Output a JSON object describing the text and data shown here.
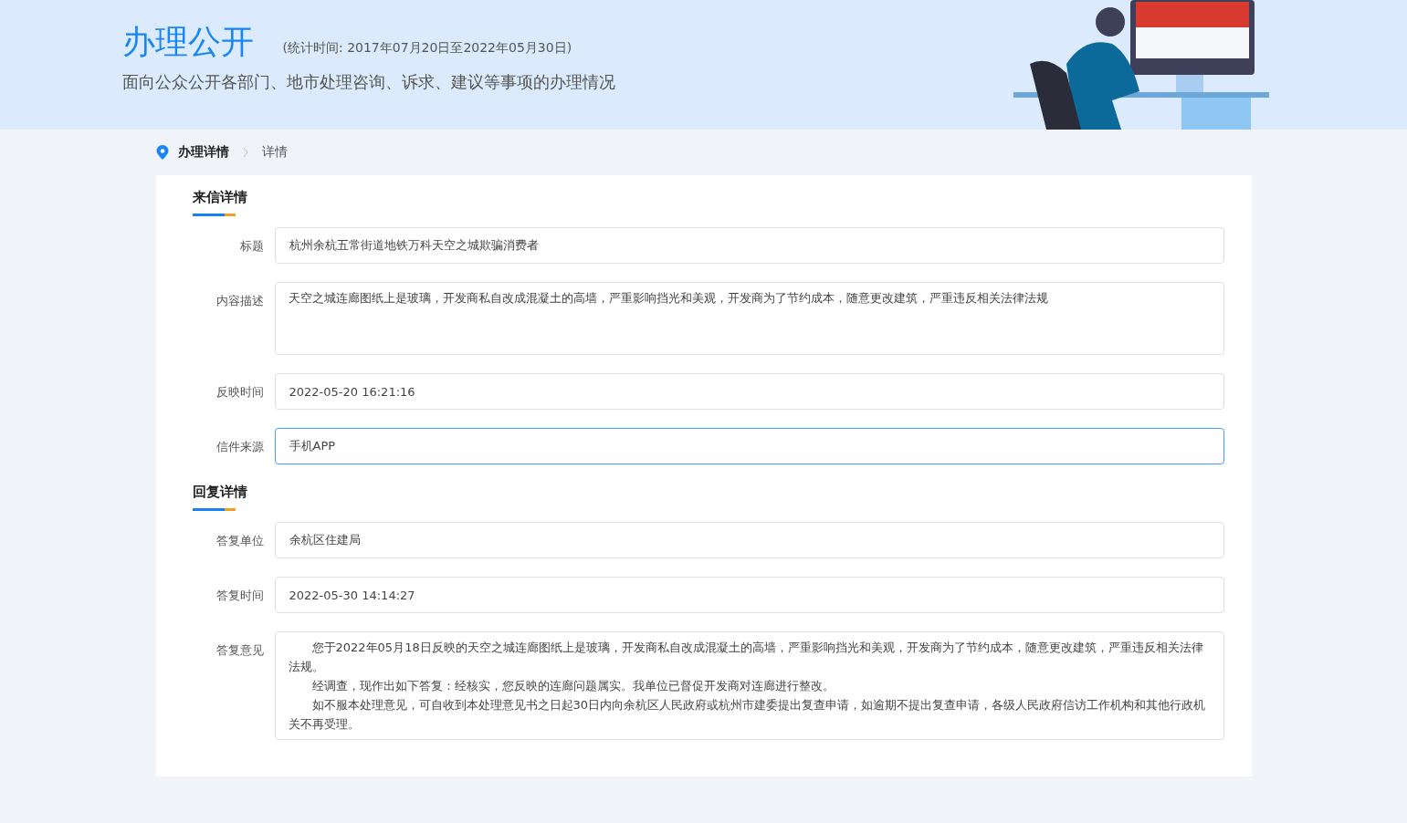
{
  "banner": {
    "title": "办理公开",
    "period": "(统计时间: 2017年07月20日至2022年05月30日)",
    "subtitle": "面向公众公开各部门、地市处理咨询、诉求、建议等事项的办理情况"
  },
  "breadcrumb": [
    {
      "label": "办理详情",
      "current": false
    },
    {
      "label": "详情",
      "current": true
    }
  ],
  "sections": [
    {
      "title": "来信详情",
      "fields": [
        {
          "label": "标题",
          "kind": "input",
          "value": "杭州余杭五常街道地铁万科天空之城欺骗消费者",
          "focused": false
        },
        {
          "label": "内容描述",
          "kind": "textarea",
          "paragraphs": [
            "天空之城连廊图纸上是玻璃，开发商私自改成混凝土的高墙，严重影响挡光和美观，开发商为了节约成本，随意更改建筑，严重违反相关法律法规"
          ],
          "indent": false,
          "focused": false
        },
        {
          "label": "反映时间",
          "kind": "input",
          "value": "2022-05-20 16:21:16",
          "focused": false
        },
        {
          "label": "信件来源",
          "kind": "input",
          "value": "手机APP",
          "focused": true
        }
      ]
    },
    {
      "title": "回复详情",
      "fields": [
        {
          "label": "答复单位",
          "kind": "input",
          "value": "余杭区住建局",
          "focused": false
        },
        {
          "label": "答复时间",
          "kind": "input",
          "value": "2022-05-30 14:14:27",
          "focused": false
        },
        {
          "label": "答复意见",
          "kind": "textarea",
          "indent": true,
          "focused": false,
          "paragraphs": [
            "您于2022年05月18日反映的天空之城连廊图纸上是玻璃，开发商私自改成混凝土的高墙，严重影响挡光和美观，开发商为了节约成本，随意更改建筑，严重违反相关法律法规。",
            "经调查，现作出如下答复：经核实，您反映的连廊问题属实。我单位已督促开发商对连廊进行整改。",
            "如不服本处理意见，可自收到本处理意见书之日起30日内向余杭区人民政府或杭州市建委提出复查申请，如逾期不提出复查申请，各级人民政府信访工作机构和其他行政机关不再受理。"
          ]
        }
      ]
    }
  ]
}
